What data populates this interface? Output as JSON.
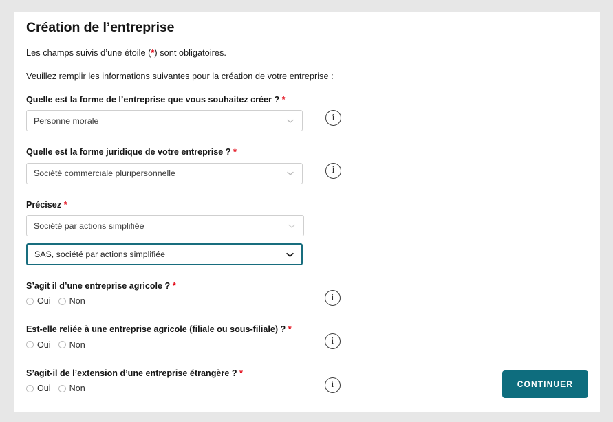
{
  "page": {
    "title": "Création de l’entreprise",
    "intro_required_note": "Les champs suivis d’une étoile (",
    "intro_required_note_end": ") sont obligatoires.",
    "required_marker": "*",
    "intro_instruction": "Veuillez remplir les informations suivantes pour la création de votre entreprise :"
  },
  "colors": {
    "page_background": "#e7e7e7",
    "card_background": "#ffffff",
    "accent_teal": "#0e6d7e",
    "focus_border": "#186d7e",
    "required_red": "#e1000f",
    "text": "#1a1a1a",
    "select_border": "#cfcfcf"
  },
  "fields": [
    {
      "id": "forme-entreprise",
      "label": "Quelle est la forme de l’entreprise que vous souhaitez créer ?",
      "required_marker": "*",
      "type": "select",
      "value": "Personne morale",
      "has_info": true,
      "focused": false
    },
    {
      "id": "forme-juridique",
      "label": "Quelle est la forme juridique de votre entreprise ?",
      "required_marker": "*",
      "type": "select",
      "value": "Société commerciale pluripersonnelle",
      "has_info": true,
      "focused": false
    },
    {
      "id": "precisez",
      "label": "Précisez",
      "required_marker": "*",
      "type": "select",
      "value": "Société par actions simplifiée",
      "has_info": false,
      "focused": false
    },
    {
      "id": "forme-detaillee",
      "label": "",
      "required_marker": "",
      "type": "select",
      "value": "SAS, société par actions simplifiée",
      "has_info": false,
      "focused": true
    }
  ],
  "radio_questions": [
    {
      "id": "entreprise-agricole",
      "label": "S’agit il d’une entreprise agricole ?",
      "required_marker": "*",
      "options": [
        {
          "label": "Oui",
          "selected": false
        },
        {
          "label": "Non",
          "selected": false
        }
      ],
      "has_info": true
    },
    {
      "id": "reliee-entreprise-agricole",
      "label": "Est-elle reliée à une entreprise agricole (filiale ou sous-filiale) ?",
      "required_marker": "*",
      "options": [
        {
          "label": "Oui",
          "selected": false
        },
        {
          "label": "Non",
          "selected": false
        }
      ],
      "has_info": true
    },
    {
      "id": "extension-entreprise-etrangere",
      "label": "S’agit-il de l’extension d’une entreprise étrangère ?",
      "required_marker": "*",
      "options": [
        {
          "label": "Oui",
          "selected": false
        },
        {
          "label": "Non",
          "selected": false
        }
      ],
      "has_info": true
    }
  ],
  "footer": {
    "continue_label": "CONTINUER"
  },
  "icons": {
    "info": "i",
    "chevron": "chevron-down-icon"
  }
}
